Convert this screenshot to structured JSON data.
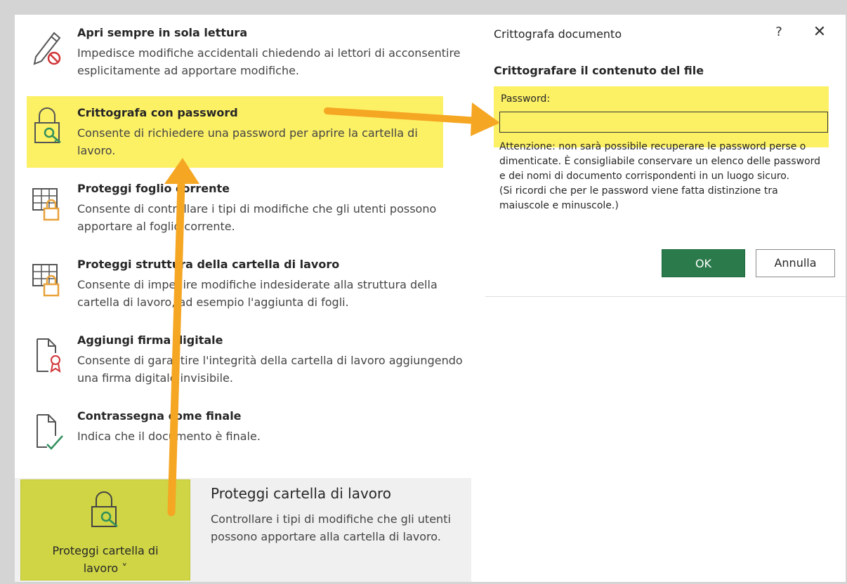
{
  "menu": {
    "items": [
      {
        "title": "Apri sempre in sola lettura",
        "desc": "Impedisce modifiche accidentali chiedendo ai lettori di acconsentire esplicitamente ad apportare modifiche.",
        "icon": "pencil-no-icon"
      },
      {
        "title": "Crittografa con password",
        "desc": "Consente di richiedere una password per aprire la cartella di lavoro.",
        "icon": "lock-key-icon"
      },
      {
        "title": "Proteggi foglio corrente",
        "desc": "Consente di controllare i tipi di modifiche che gli utenti possono apportare al foglio corrente.",
        "icon": "sheet-lock-icon"
      },
      {
        "title": "Proteggi struttura della cartella di lavoro",
        "desc": "Consente di impedire modifiche indesiderate alla struttura della cartella di lavoro, ad esempio l'aggiunta di fogli.",
        "icon": "workbook-lock-icon"
      },
      {
        "title": "Aggiungi firma digitale",
        "desc": "Consente di garantire l'integrità della cartella di lavoro aggiungendo una firma digitale invisibile.",
        "icon": "document-ribbon-icon"
      },
      {
        "title": "Contrassegna come finale",
        "desc": "Indica che il documento è finale.",
        "icon": "document-check-icon"
      }
    ]
  },
  "protect": {
    "button_label": "Proteggi cartella di lavoro ˅",
    "section_title": "Proteggi cartella di lavoro",
    "section_desc": "Controllare i tipi di modifiche che gli utenti possono apportare alla cartella di lavoro.",
    "icon": "lock-key-icon"
  },
  "dialog": {
    "title": "Crittografa documento",
    "help": "?",
    "close": "✕",
    "heading": "Crittografare il contenuto del file",
    "password_label": "Password:",
    "password_value": "",
    "warning": "Attenzione: non sarà possibile recuperare le password perse o dimenticate. È consigliabile conservare un elenco delle password e dei nomi di documento corrispondenti in un luogo sicuro.\n(Si ricordi che per le password viene fatta distinzione tra maiuscole e minuscole.)",
    "ok": "OK",
    "cancel": "Annulla"
  },
  "colors": {
    "highlight": "#fcf065",
    "button_highlight": "#cfd545",
    "ok_green": "#2b7a4b",
    "arrow": "#f5a623",
    "lock_gold": "#e8a23c",
    "key_green": "#2f8f5b"
  }
}
